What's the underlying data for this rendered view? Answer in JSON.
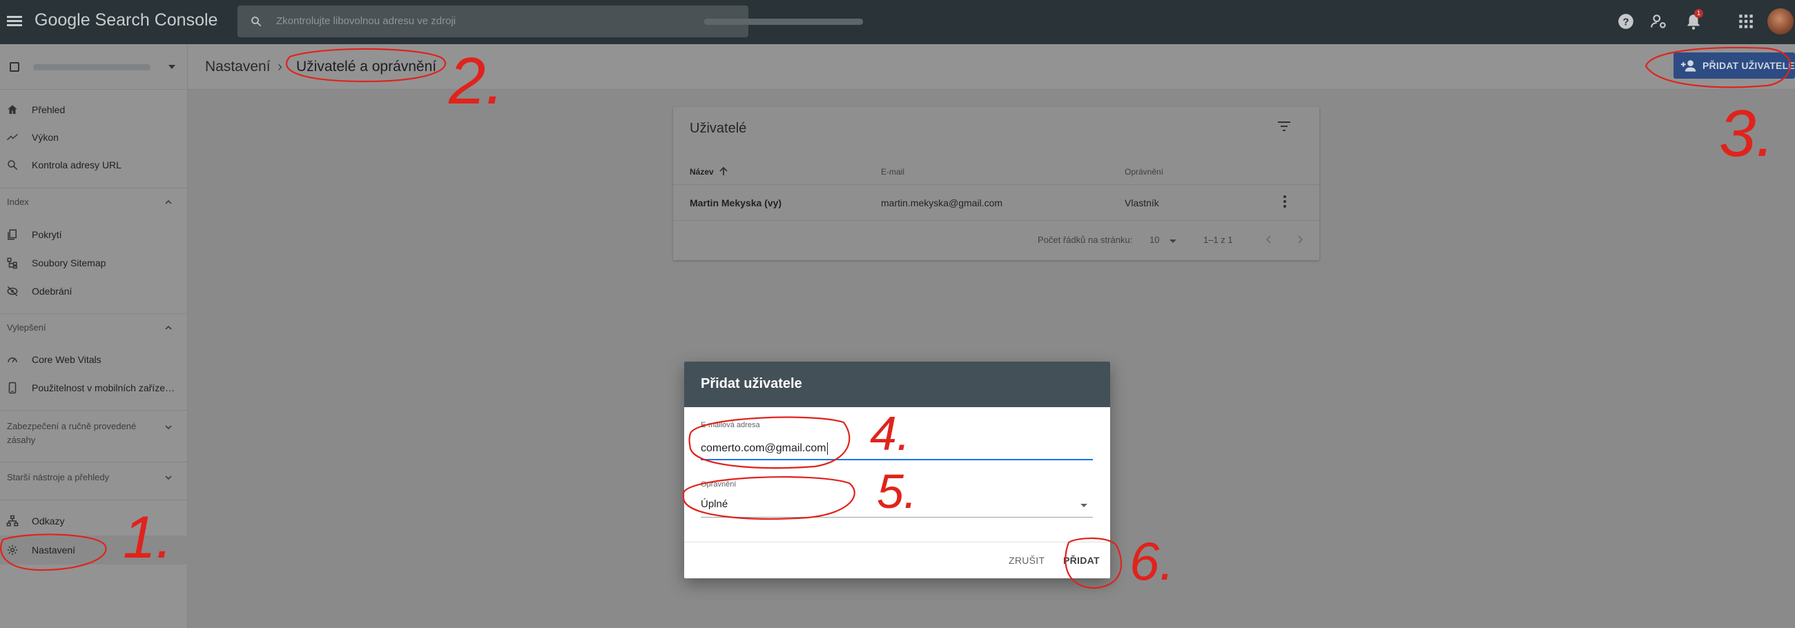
{
  "app": {
    "logo_text": "Google Search Console",
    "search_placeholder": "Zkontrolujte libovolnou adresu ve zdroji",
    "notification_count": "1"
  },
  "sidebar": {
    "items_top": [
      {
        "label": "Přehled",
        "icon": "home-icon"
      },
      {
        "label": "Výkon",
        "icon": "trending-up-icon"
      },
      {
        "label": "Kontrola adresy URL",
        "icon": "search-icon"
      }
    ],
    "sections": [
      {
        "label": "Index",
        "expanded": true
      },
      {
        "label": "Vylepšení",
        "expanded": true
      },
      {
        "label": "Zabezpečení a ručně provedené zásahy",
        "expanded": false
      },
      {
        "label": "Starší nástroje a přehledy",
        "expanded": false
      }
    ],
    "index_items": [
      {
        "label": "Pokrytí",
        "icon": "coverage-icon"
      },
      {
        "label": "Soubory Sitemap",
        "icon": "sitemap-icon"
      },
      {
        "label": "Odebrání",
        "icon": "removal-icon"
      }
    ],
    "enhancement_items": [
      {
        "label": "Core Web Vitals",
        "icon": "gauge-icon"
      },
      {
        "label": "Použitelnost v mobilních zaříze…",
        "icon": "phone-icon"
      }
    ],
    "bottom_items": [
      {
        "label": "Odkazy",
        "icon": "links-icon"
      },
      {
        "label": "Nastavení",
        "icon": "gear-icon",
        "active": true
      }
    ]
  },
  "breadcrumb": {
    "parent": "Nastavení",
    "separator": "›",
    "current": "Uživatelé a oprávnění"
  },
  "toolbar": {
    "add_user_label": "PŘIDAT UŽIVATELE",
    "accent_color": "#2d4c84"
  },
  "users_card": {
    "title": "Uživatelé",
    "columns": [
      "Název",
      "E-mail",
      "Oprávnění"
    ],
    "rows": [
      {
        "name": "Martin Mekyska (vy)",
        "email": "martin.mekyska@gmail.com",
        "permission": "Vlastník"
      }
    ],
    "pagination": {
      "rows_per_page_label": "Počet řádků na stránku:",
      "rows_per_page": "10",
      "range": "1–1 z 1"
    }
  },
  "dialog": {
    "title": "Přidat uživatele",
    "email_label": "E-mailová adresa",
    "email_value": "comerto.com@gmail.com",
    "permission_label": "Oprávnění",
    "permission_value": "Úplné",
    "cancel_label": "ZRUŠIT",
    "add_label": "PŘIDAT",
    "header_color": "#445058"
  },
  "annotations": {
    "numbers": [
      "1.",
      "2.",
      "3.",
      "4.",
      "5.",
      "6."
    ],
    "color": "#e0231c"
  }
}
